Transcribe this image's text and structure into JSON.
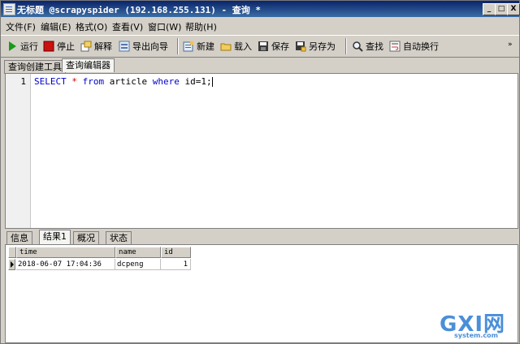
{
  "window": {
    "title": "无标题 @scrapyspider (192.168.255.131) - 查询 *",
    "controls": {
      "minimize": "_",
      "maximize": "□",
      "close": "X"
    }
  },
  "menu": [
    "文件(F)",
    "编辑(E)",
    "格式(O)",
    "查看(V)",
    "窗口(W)",
    "帮助(H)"
  ],
  "toolbar": {
    "run": "运行",
    "stop": "停止",
    "explain": "解释",
    "export": "导出向导",
    "new": "新建",
    "load": "载入",
    "save": "保存",
    "save_as": "另存为",
    "find": "查找",
    "wrap": "自动换行"
  },
  "top_tabs": [
    "查询创建工具",
    "查询编辑器"
  ],
  "editor": {
    "line_number": "1",
    "tokens": {
      "select": "SELECT",
      "star": " * ",
      "from": "from",
      "table": " article ",
      "where": "where",
      "cond": " id=1;"
    }
  },
  "bottom_tabs": [
    "信息",
    "结果1",
    "概况",
    "状态"
  ],
  "results": {
    "columns": [
      "time",
      "name",
      "id"
    ],
    "rows": [
      [
        "2018-06-07 17:04:36",
        "dcpeng",
        "1"
      ]
    ]
  },
  "watermark": {
    "brand": "GXI网",
    "domain": "system.com"
  }
}
